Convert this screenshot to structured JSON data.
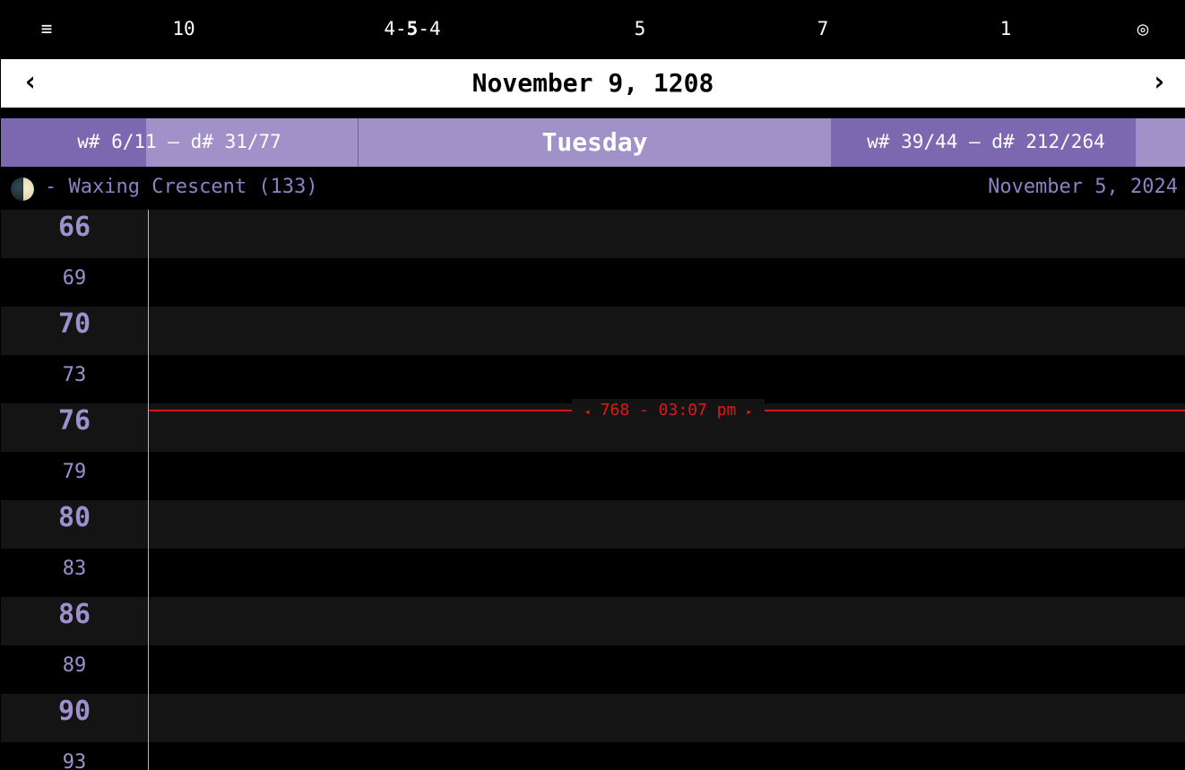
{
  "topbar": {
    "menu_icon": "hamburger-menu-icon",
    "menu_glyph": "≡",
    "item1": "10",
    "item2_pre": "4-",
    "item2_bold": "5",
    "item2_post": "-4",
    "item3": "5",
    "item4": "7",
    "item5": "1",
    "target_icon": "target-icon",
    "target_glyph": "◎"
  },
  "datebar": {
    "prev_glyph": "‹",
    "title": "November 9, 1208",
    "next_glyph": "›"
  },
  "weekband": {
    "left_text": "w# 6/11 — d# 31/77",
    "day_name": "Tuesday",
    "right_text": "w# 39/44 — d# 212/264",
    "left_progress_fraction": 0.41,
    "right_progress_fraction": 0.86
  },
  "moon": {
    "icon": "waxing-crescent-moon-icon",
    "text": "- Waxing Crescent (133)",
    "date": "November 5, 2024"
  },
  "time_rows": [
    {
      "label": "66",
      "major": true
    },
    {
      "label": "69",
      "major": false
    },
    {
      "label": "70",
      "major": true
    },
    {
      "label": "73",
      "major": false
    },
    {
      "label": "76",
      "major": true
    },
    {
      "label": "79",
      "major": false
    },
    {
      "label": "80",
      "major": true
    },
    {
      "label": "83",
      "major": false
    },
    {
      "label": "86",
      "major": true
    },
    {
      "label": "89",
      "major": false
    },
    {
      "label": "90",
      "major": true
    },
    {
      "label": "93",
      "major": false
    }
  ],
  "now_indicator": {
    "left_arrow": "◂",
    "text": "768 - 03:07 pm",
    "right_arrow": "▸"
  },
  "colors": {
    "accent_dark": "#7b68b0",
    "accent_light": "#a091c8",
    "label_purple": "#9d90cc",
    "now_red": "#d61515"
  }
}
